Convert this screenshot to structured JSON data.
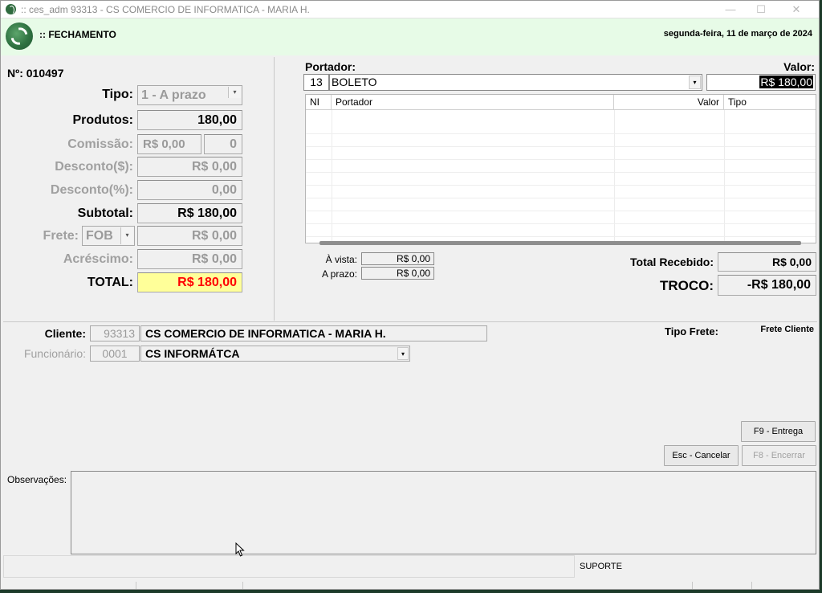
{
  "window": {
    "title": ":: ces_adm 93313 - CS COMERCIO DE INFORMATICA - MARIA H.",
    "controls": [
      "—",
      "☐",
      "✕"
    ]
  },
  "header": {
    "screen_title": ":: FECHAMENTO",
    "date": "segunda-feira, 11 de março de 2024"
  },
  "left": {
    "numero": "Nº: 010497",
    "tipo_label": "Tipo:",
    "tipo_value": "1 - A prazo",
    "produtos_label": "Produtos:",
    "produtos_value": "180,00",
    "comissao_label": "Comissão:",
    "comissao_value": "R$ 0,00",
    "comissao_qty": "0",
    "desconto_rs_label": "Desconto($):",
    "desconto_rs_value": "R$ 0,00",
    "desconto_pct_label": "Desconto(%):",
    "desconto_pct_value": "0,00",
    "subtotal_label": "Subtotal:",
    "subtotal_value": "R$ 180,00",
    "frete_label": "Frete:",
    "frete_type": "FOB",
    "frete_value": "R$ 0,00",
    "acrescimo_label": "Acréscimo:",
    "acrescimo_value": "R$ 0,00",
    "total_label": "TOTAL:",
    "total_value": "R$ 180,00"
  },
  "right": {
    "portador_label": "Portador:",
    "valor_label": "Valor:",
    "portador_code": "13",
    "portador_name": "BOLETO",
    "valor_input": "R$ 180,00",
    "grid_columns": [
      "NI",
      "Portador",
      "Valor",
      "Tipo"
    ],
    "avista_label": "À vista:",
    "avista_value": "R$ 0,00",
    "aprazo_label": "A prazo:",
    "aprazo_value": "R$ 0,00",
    "total_recebido_label": "Total Recebido:",
    "total_recebido_value": "R$ 0,00",
    "troco_label": "TROCO:",
    "troco_value": "-R$ 180,00"
  },
  "bottom": {
    "cliente_label": "Cliente:",
    "cliente_code": "93313",
    "cliente_name": "CS COMERCIO DE INFORMATICA - MARIA H.",
    "funcionario_label": "Funcionário:",
    "funcionario_code": "0001",
    "funcionario_name": "CS INFORMÁTCA",
    "tipo_frete_label": "Tipo Frete:",
    "tipo_frete_value": "Frete Cliente",
    "btn_entrega": "F9 - Entrega",
    "btn_cancelar": "Esc - Cancelar",
    "btn_encerrar": "F8 - Encerrar",
    "observacoes_label": "Observações:",
    "status_text": "SUPORTE"
  },
  "colors": {
    "header_bg": "#e7fbe7",
    "total_bg": "#ffff99",
    "total_text": "#ff0000"
  }
}
